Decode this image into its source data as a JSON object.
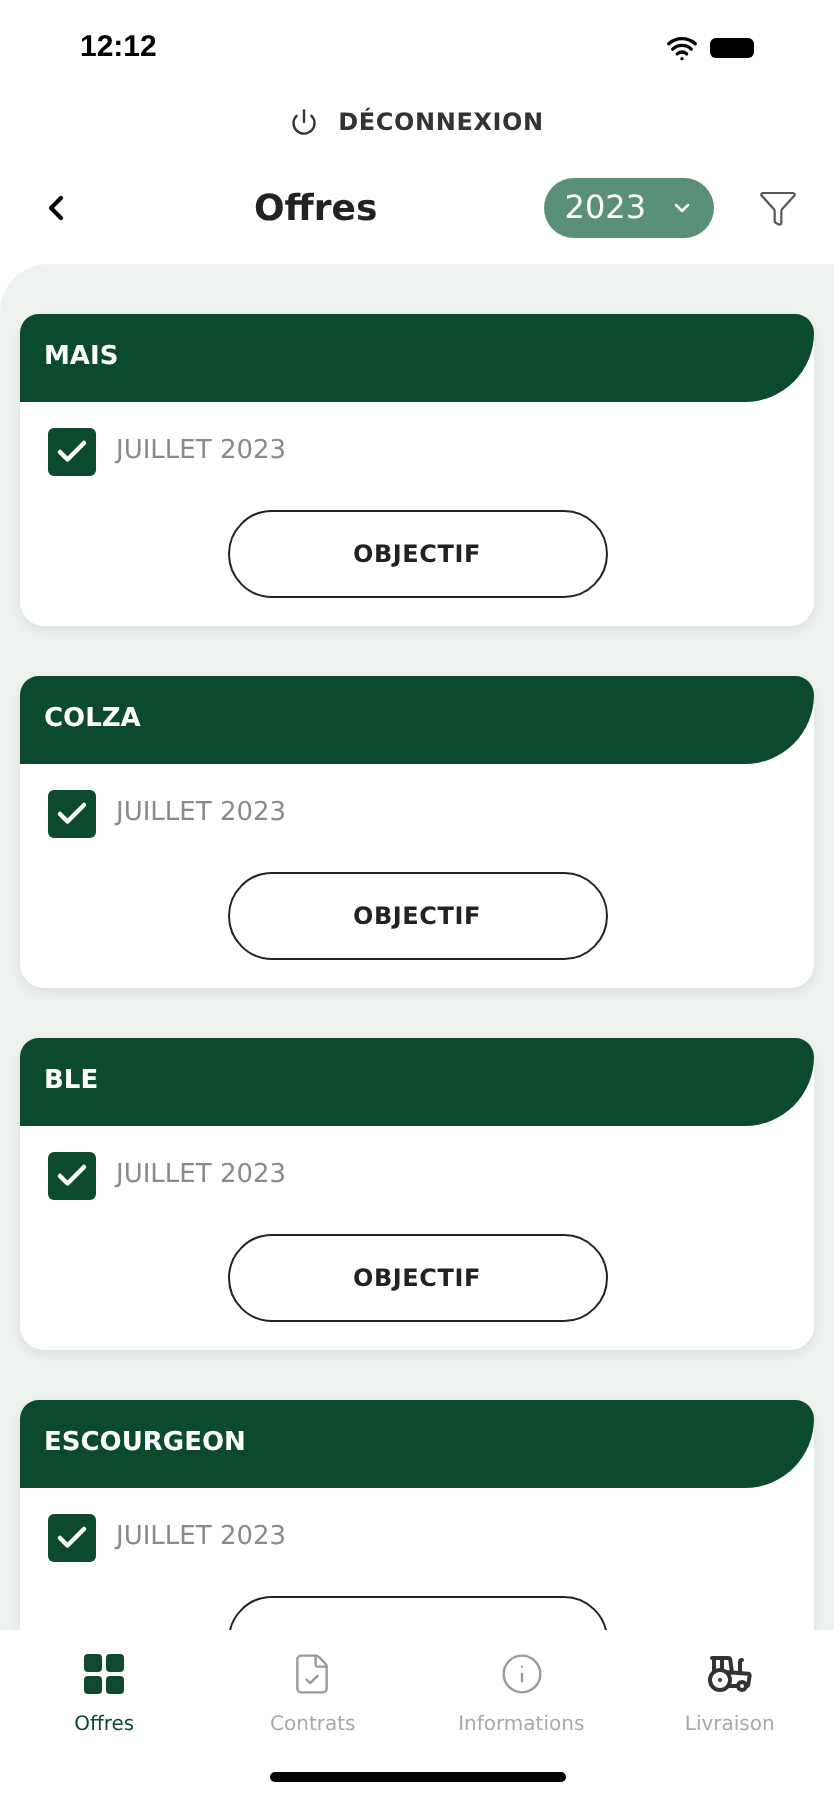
{
  "status_bar": {
    "time": "12:12"
  },
  "logout": {
    "label": "DÉCONNEXION"
  },
  "header": {
    "title": "Offres",
    "year": "2023"
  },
  "offers": [
    {
      "name": "MAIS",
      "period": "JUILLET 2023",
      "checked": true,
      "button": "OBJECTIF"
    },
    {
      "name": "COLZA",
      "period": "JUILLET 2023",
      "checked": true,
      "button": "OBJECTIF"
    },
    {
      "name": "BLE",
      "period": "JUILLET 2023",
      "checked": true,
      "button": "OBJECTIF"
    },
    {
      "name": "ESCOURGEON",
      "period": "JUILLET 2023",
      "checked": true
    }
  ],
  "tab_bar": [
    {
      "kind": "grid",
      "label": "Offres",
      "selected": true
    },
    {
      "kind": "contract",
      "label": "Contrats",
      "selected": false
    },
    {
      "kind": "info",
      "label": "Informations",
      "selected": false
    },
    {
      "kind": "tractor",
      "label": "Livraison",
      "selected": false
    }
  ]
}
